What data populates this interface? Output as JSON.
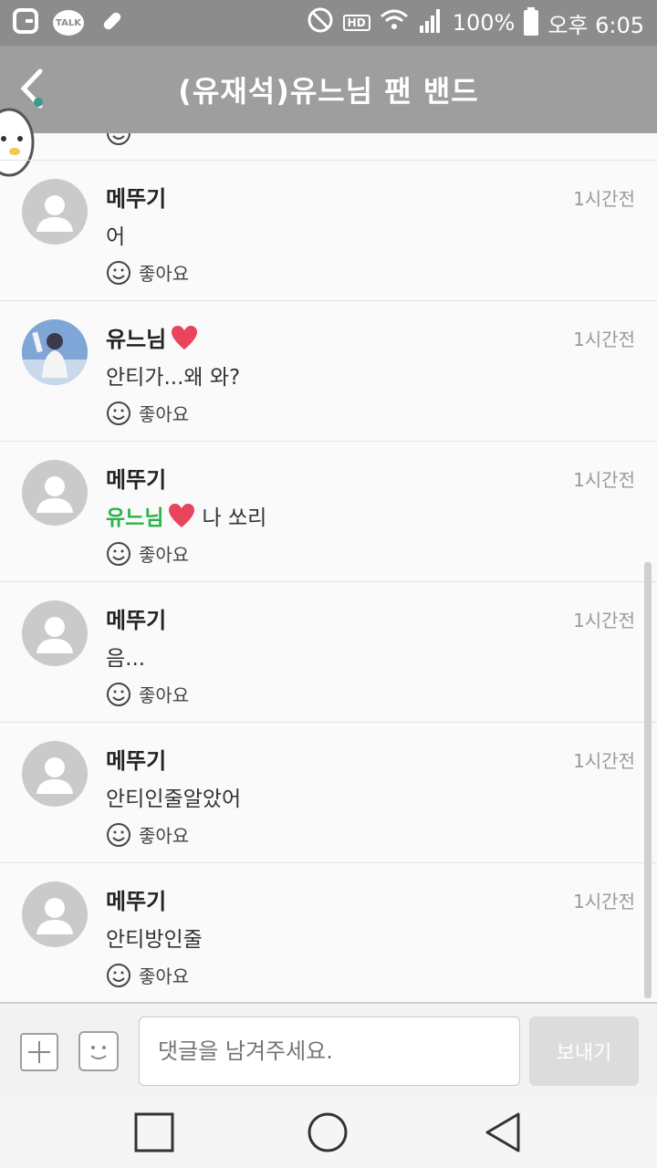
{
  "status_bar": {
    "battery": "100%",
    "time": "오후 6:05",
    "icons": [
      "g-app-icon",
      "kakaotalk-icon",
      "pill-icon",
      "do-not-disturb-icon",
      "hd-icon",
      "wifi-icon",
      "signal-icon",
      "battery-icon"
    ]
  },
  "header": {
    "title": "(유재석)유느님 팬 밴드"
  },
  "comments": [
    {
      "name": "메뚜기",
      "time": "1시간전",
      "message": "어",
      "like_label": "좋아요"
    },
    {
      "name": "유느님",
      "time": "1시간전",
      "message": "안티가...왜 와?",
      "like_label": "좋아요"
    },
    {
      "name": "메뚜기",
      "time": "1시간전",
      "mention": "유느님",
      "message": "나 쏘리",
      "like_label": "좋아요"
    },
    {
      "name": "메뚜기",
      "time": "1시간전",
      "message": "음...",
      "like_label": "좋아요"
    },
    {
      "name": "메뚜기",
      "time": "1시간전",
      "message": "안티인줄알았어",
      "like_label": "좋아요"
    },
    {
      "name": "메뚜기",
      "time": "1시간전",
      "message": "안티방인줄",
      "like_label": "좋아요"
    }
  ],
  "composer": {
    "placeholder": "댓글을 남겨주세요.",
    "send_label": "보내기"
  },
  "colors": {
    "header_bg": "#9e9e9e",
    "mention": "#2bb34a",
    "heart": "#e8455c"
  }
}
